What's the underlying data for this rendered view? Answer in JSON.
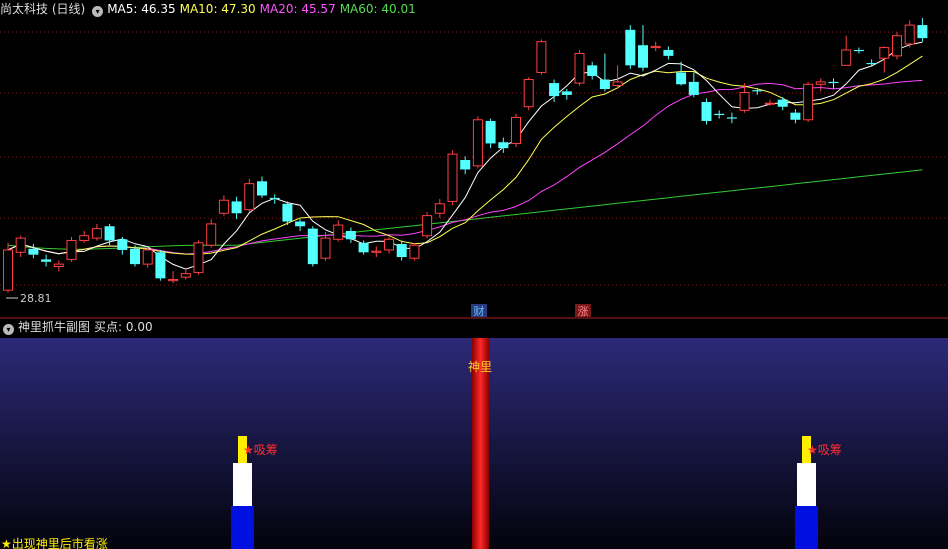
{
  "main_header": {
    "title": "尚太科技 (日线)",
    "ma_labels": [
      {
        "name": "MA5",
        "value": "46.35",
        "color": "#ffffff"
      },
      {
        "name": "MA10",
        "value": "47.30",
        "color": "#ffff55"
      },
      {
        "name": "MA20",
        "value": "45.57",
        "color": "#ff55ff"
      },
      {
        "name": "MA60",
        "value": "40.01",
        "color": "#55dd55"
      }
    ]
  },
  "sub_header": {
    "title": "神里抓牛副图",
    "buy_label": "买点: 0.00"
  },
  "low_label": "28.81",
  "markers": [
    {
      "text": "财",
      "bg": "#2a3a7a",
      "color": "#66bbff"
    },
    {
      "text": "涨",
      "bg": "#7a1a1a",
      "color": "#ff8888"
    }
  ],
  "sub_labels": {
    "shenli": "神里",
    "xichou_1": "★吸筹",
    "xichou_2": "★吸筹",
    "footer": "★出现神里后市看涨"
  },
  "colors": {
    "up": "#ff4040",
    "down": "#54ffff",
    "ma5": "#ffffff",
    "ma10": "#ffff55",
    "ma20": "#ff44ff",
    "ma60": "#33cc33",
    "grid": "#8a1a1a"
  },
  "chart_data": {
    "type": "candlestick",
    "ylim": [
      28,
      52
    ],
    "series": [
      {
        "name": "MA5",
        "value": 46.35
      },
      {
        "name": "MA10",
        "value": 47.3
      },
      {
        "name": "MA20",
        "value": 45.57
      },
      {
        "name": "MA60",
        "value": 40.01
      }
    ],
    "candles": [
      [
        29.0,
        32.4,
        33.0,
        28.8
      ],
      [
        32.2,
        33.4,
        33.6,
        31.8
      ],
      [
        32.5,
        32.0,
        32.9,
        31.7
      ],
      [
        31.6,
        31.4,
        32.0,
        31.0
      ],
      [
        31.0,
        31.2,
        31.5,
        30.6
      ],
      [
        31.6,
        33.2,
        33.5,
        31.4
      ],
      [
        33.2,
        33.6,
        34.0,
        33.0
      ],
      [
        33.4,
        34.2,
        34.6,
        33.2
      ],
      [
        34.4,
        33.2,
        34.6,
        32.8
      ],
      [
        33.3,
        32.4,
        33.5,
        32.0
      ],
      [
        32.5,
        31.2,
        32.8,
        31.0
      ],
      [
        31.2,
        32.4,
        32.6,
        30.9
      ],
      [
        32.2,
        30.0,
        32.4,
        29.8
      ],
      [
        29.8,
        29.9,
        30.6,
        29.6
      ],
      [
        30.1,
        30.4,
        30.9,
        29.9
      ],
      [
        30.5,
        33.0,
        33.2,
        30.3
      ],
      [
        32.8,
        34.6,
        35.0,
        32.6
      ],
      [
        35.5,
        36.6,
        37.0,
        35.3
      ],
      [
        36.5,
        35.5,
        36.9,
        35.0
      ],
      [
        35.8,
        38.0,
        38.4,
        35.6
      ],
      [
        38.2,
        37.0,
        38.6,
        36.8
      ],
      [
        36.8,
        36.7,
        37.1,
        36.3
      ],
      [
        36.3,
        34.8,
        36.5,
        34.5
      ],
      [
        34.8,
        34.4,
        35.0,
        34.0
      ],
      [
        34.2,
        31.2,
        34.4,
        31.0
      ],
      [
        31.7,
        33.4,
        33.9,
        31.5
      ],
      [
        33.3,
        34.5,
        34.9,
        33.1
      ],
      [
        34.0,
        33.3,
        34.3,
        33.0
      ],
      [
        33.0,
        32.2,
        33.2,
        32.0
      ],
      [
        32.2,
        32.3,
        32.7,
        31.8
      ],
      [
        32.4,
        33.3,
        33.5,
        32.1
      ],
      [
        32.9,
        31.8,
        33.2,
        31.5
      ],
      [
        31.7,
        32.8,
        33.0,
        31.5
      ],
      [
        33.6,
        35.3,
        35.6,
        33.4
      ],
      [
        35.5,
        36.3,
        36.7,
        35.1
      ],
      [
        36.5,
        40.5,
        40.8,
        36.2
      ],
      [
        40.0,
        39.2,
        40.3,
        38.8
      ],
      [
        39.5,
        43.4,
        43.7,
        39.3
      ],
      [
        43.3,
        41.4,
        43.5,
        41.0
      ],
      [
        41.5,
        41.0,
        41.9,
        40.6
      ],
      [
        41.4,
        43.6,
        43.9,
        41.1
      ],
      [
        44.5,
        46.8,
        47.0,
        44.2
      ],
      [
        47.4,
        50.0,
        50.2,
        47.2
      ],
      [
        46.5,
        45.4,
        46.8,
        44.9
      ],
      [
        45.8,
        45.5,
        46.0,
        45.1
      ],
      [
        46.5,
        49.0,
        49.3,
        46.3
      ],
      [
        48.0,
        47.1,
        48.3,
        46.8
      ],
      [
        46.8,
        46.0,
        49.0,
        45.8
      ],
      [
        46.3,
        46.6,
        48.0,
        46.0
      ],
      [
        51.0,
        48.0,
        51.4,
        47.7
      ],
      [
        49.7,
        47.8,
        51.4,
        47.5
      ],
      [
        49.5,
        49.6,
        50.0,
        49.2
      ],
      [
        49.3,
        48.8,
        49.6,
        48.5
      ],
      [
        47.4,
        46.4,
        48.3,
        46.3
      ],
      [
        46.6,
        45.5,
        47.4,
        45.3
      ],
      [
        44.9,
        43.3,
        45.2,
        43.0
      ],
      [
        43.9,
        43.8,
        44.2,
        43.5
      ],
      [
        43.6,
        43.5,
        44.0,
        43.1
      ],
      [
        44.2,
        45.7,
        46.5,
        44.0
      ],
      [
        45.9,
        45.8,
        46.1,
        45.5
      ],
      [
        44.8,
        44.8,
        45.1,
        44.6
      ],
      [
        45.1,
        44.5,
        45.3,
        44.2
      ],
      [
        44.0,
        43.4,
        44.3,
        43.1
      ],
      [
        43.4,
        46.4,
        46.6,
        43.2
      ],
      [
        46.4,
        46.6,
        46.9,
        45.8
      ],
      [
        46.6,
        46.5,
        46.9,
        46.0
      ],
      [
        48.0,
        49.3,
        50.5,
        48.5
      ],
      [
        49.3,
        49.2,
        49.5,
        49.0
      ],
      [
        48.2,
        48.1,
        48.5,
        47.9
      ],
      [
        48.6,
        49.5,
        49.6,
        47.4
      ],
      [
        48.8,
        50.5,
        50.8,
        48.5
      ],
      [
        49.8,
        51.4,
        51.8,
        49.5
      ],
      [
        51.4,
        50.3,
        52.0,
        50.0
      ]
    ]
  }
}
